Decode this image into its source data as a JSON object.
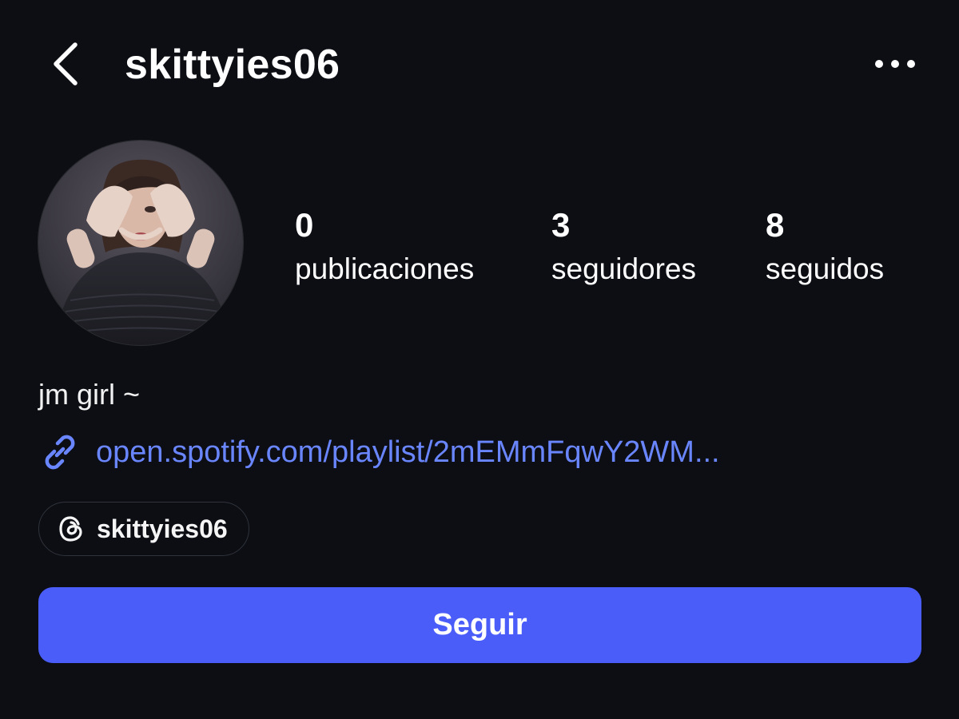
{
  "header": {
    "username": "skittyies06",
    "back_icon": "chevron-left-icon",
    "more_icon": "more-horizontal-icon"
  },
  "profile": {
    "avatar_icon": "profile-photo",
    "stats": [
      {
        "count": "0",
        "label": "publicaciones"
      },
      {
        "count": "3",
        "label": "seguidores"
      },
      {
        "count": "8",
        "label": "seguidos"
      }
    ]
  },
  "bio": {
    "text": "jm girl ~",
    "link_icon": "link-icon",
    "link": "open.spotify.com/playlist/2mEMmFqwY2WM..."
  },
  "threads": {
    "icon": "threads-icon",
    "handle": "skittyies06"
  },
  "actions": {
    "follow_label": "Seguir"
  },
  "colors": {
    "background": "#0c0e14",
    "accent": "#4a5df9",
    "link": "#6a86ff",
    "chip_border": "#30333b"
  }
}
